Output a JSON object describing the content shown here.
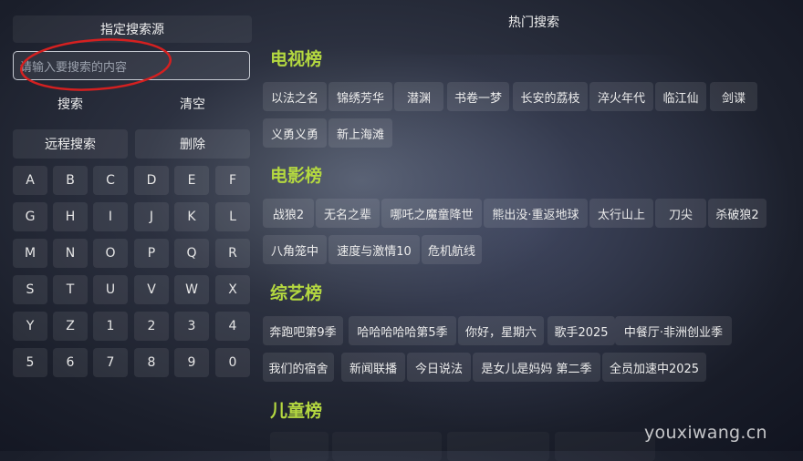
{
  "search_panel": {
    "source_label": "指定搜索源",
    "search_placeholder": "请输入要搜索的内容",
    "search_button": "搜索",
    "clear_button": "清空",
    "remote_search_button": "远程搜索",
    "delete_button": "删除",
    "keyboard": [
      "A",
      "B",
      "C",
      "D",
      "E",
      "F",
      "G",
      "H",
      "I",
      "J",
      "K",
      "L",
      "M",
      "N",
      "O",
      "P",
      "Q",
      "R",
      "S",
      "T",
      "U",
      "V",
      "W",
      "X",
      "Y",
      "Z",
      "1",
      "2",
      "3",
      "4",
      "5",
      "6",
      "7",
      "8",
      "9",
      "0"
    ]
  },
  "hot": {
    "title": "热门搜索",
    "tv": {
      "title": "电视榜",
      "items": [
        "以法之名",
        "锦绣芳华",
        "潜渊",
        "书卷一梦",
        "长安的荔枝",
        "淬火年代",
        "临江仙",
        "剑谍",
        "义勇义勇",
        "新上海滩"
      ]
    },
    "movie": {
      "title": "电影榜",
      "items": [
        "战狼2",
        "无名之辈",
        "哪吒之魔童降世",
        "熊出没·重返地球",
        "太行山上",
        "刀尖",
        "杀破狼2",
        "八角笼中",
        "速度与激情10",
        "危机航线"
      ]
    },
    "variety": {
      "title": "综艺榜",
      "items": [
        "奔跑吧第9季",
        "哈哈哈哈哈第5季",
        "你好，星期六",
        "歌手2025",
        "中餐厅·非洲创业季",
        "我们的宿舍",
        "新闻联播",
        "今日说法",
        "是女儿是妈妈 第二季",
        "全员加速中2025"
      ]
    },
    "kids": {
      "title": "儿童榜"
    }
  },
  "annotation_color": "#d42020",
  "accent_color": "#b4d840",
  "watermark": "youxiwang.cn"
}
